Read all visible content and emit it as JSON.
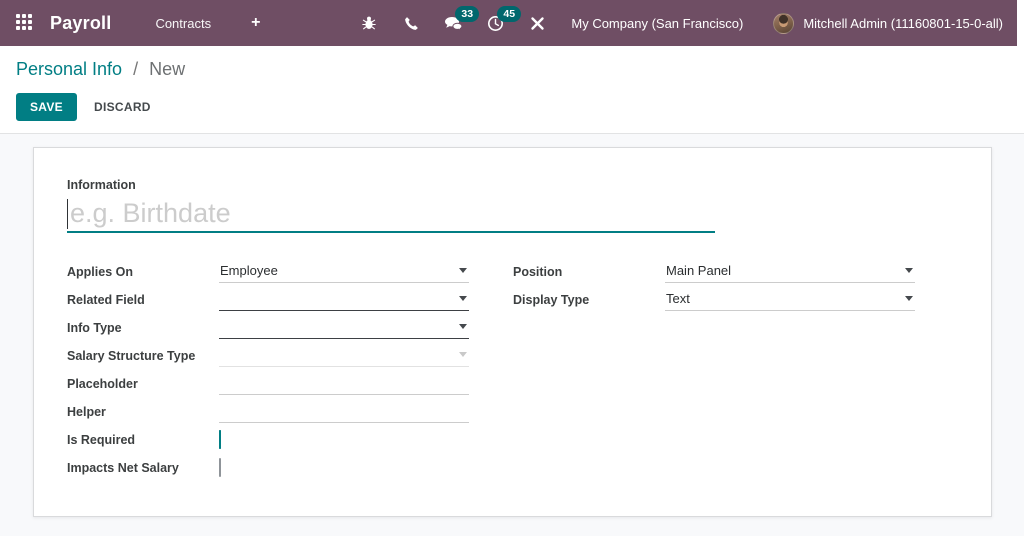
{
  "colors": {
    "navbar": "#6f4e64",
    "accent": "#017e84",
    "badge": "#01676d"
  },
  "navbar": {
    "app_name": "Payroll",
    "menu": {
      "contracts": "Contracts"
    },
    "plus": "+",
    "icons": {
      "bug": {
        "name": "bug-icon"
      },
      "phone": {
        "name": "phone-icon"
      },
      "messages": {
        "name": "messages-icon",
        "badge": "33"
      },
      "activities": {
        "name": "activities-icon",
        "badge": "45"
      },
      "close": {
        "name": "close-icon"
      }
    },
    "company": "My Company (San Francisco)",
    "user_name": "Mitchell Admin (11160801-15-0-all)"
  },
  "breadcrumb": {
    "parent": "Personal Info",
    "separator": "/",
    "current": "New"
  },
  "control_panel": {
    "save_label": "SAVE",
    "discard_label": "DISCARD"
  },
  "form": {
    "information": {
      "label": "Information",
      "placeholder": "e.g. Birthdate"
    },
    "applies_on": {
      "label": "Applies On",
      "value": "Employee"
    },
    "related_field": {
      "label": "Related Field",
      "value": ""
    },
    "info_type": {
      "label": "Info Type",
      "value": ""
    },
    "salary_structure_type": {
      "label": "Salary Structure Type",
      "value": ""
    },
    "placeholder_field": {
      "label": "Placeholder",
      "value": ""
    },
    "helper": {
      "label": "Helper",
      "value": ""
    },
    "is_required": {
      "label": "Is Required",
      "checked": true
    },
    "impacts_net_salary": {
      "label": "Impacts Net Salary",
      "checked": false
    },
    "position": {
      "label": "Position",
      "value": "Main Panel"
    },
    "display_type": {
      "label": "Display Type",
      "value": "Text"
    }
  }
}
